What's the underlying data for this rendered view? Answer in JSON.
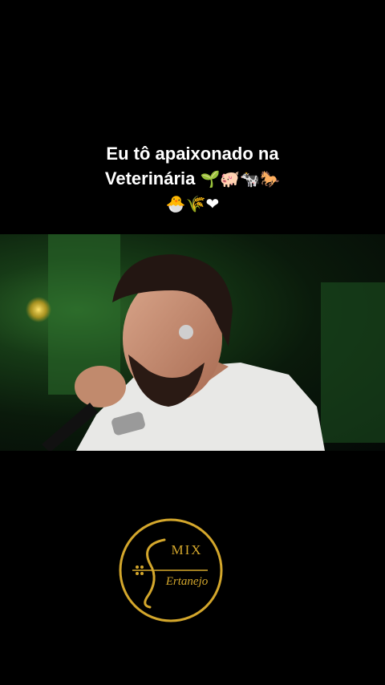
{
  "caption": {
    "line1": "Eu tô apaixonado na",
    "line2_text": "Veterinária",
    "line2_emoji": "🌱🐖🐄🐎",
    "line3_emoji": "🐣🌾❤"
  },
  "logo": {
    "top_text": "MIX",
    "bottom_text": "Ertanejo",
    "accent_color": "#d4a72c"
  },
  "colors": {
    "background": "#000000",
    "caption_text": "#ffffff"
  }
}
